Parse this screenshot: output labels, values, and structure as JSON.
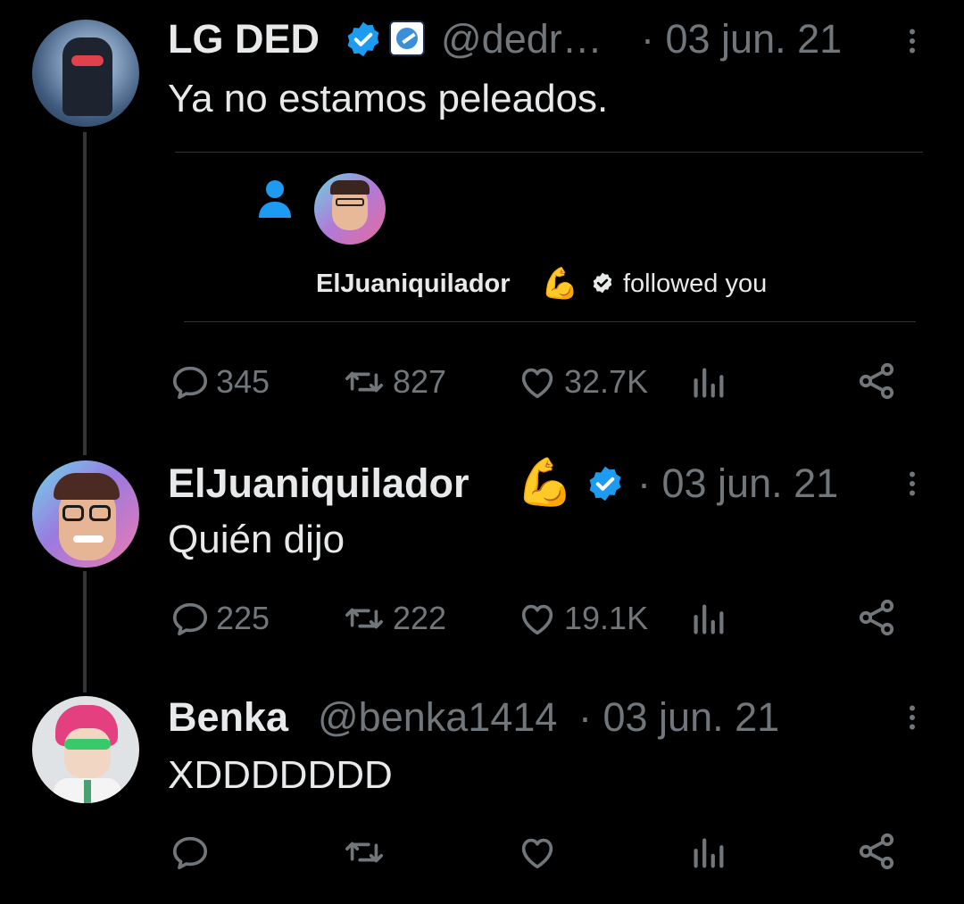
{
  "colors": {
    "background": "#000000",
    "text": "#e7e9ea",
    "muted": "#71767b",
    "verified": "#1d9bf0",
    "follow_icon": "#1d9bf0"
  },
  "tweets": [
    {
      "display_name": "LG DED",
      "handle": "@dedr…",
      "date": "· 03 jun. 21",
      "text": "Ya no estamos peleados.",
      "badges": [
        "verified-icon",
        "affiliate-badge-icon"
      ],
      "quote_card": {
        "user": "ElJuaniquilador",
        "emoji": "💪",
        "action": "followed you"
      },
      "stats": {
        "replies": "345",
        "reposts": "827",
        "likes": "32.7K"
      }
    },
    {
      "display_name": "ElJuaniquilador",
      "emoji": "💪",
      "date": "· 03 jun. 21",
      "text": "Quién dijo",
      "badges": [
        "verified-icon"
      ],
      "stats": {
        "replies": "225",
        "reposts": "222",
        "likes": "19.1K"
      }
    },
    {
      "display_name": "Benka",
      "handle": "@benka1414",
      "date": "· 03 jun. 21",
      "text": "XDDDDDDD",
      "stats": {
        "replies": "",
        "reposts": "",
        "likes": ""
      }
    }
  ]
}
